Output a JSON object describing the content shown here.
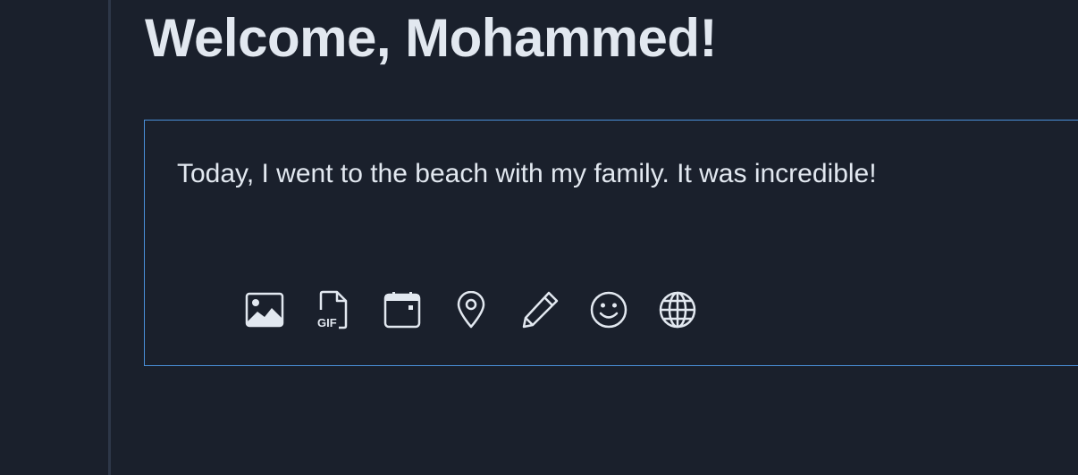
{
  "header": {
    "welcome": "Welcome, Mohammed!"
  },
  "composer": {
    "text": "Today, I went to the beach with my family. It was incredible!",
    "toolbar": {
      "icons": [
        "image-icon",
        "gif-icon",
        "calendar-icon",
        "location-icon",
        "pencil-icon",
        "emoji-icon",
        "globe-icon"
      ],
      "gif_label": "GIF"
    }
  },
  "colors": {
    "background": "#1a202c",
    "text": "#e2e8f0",
    "accent_border": "#4a90d9",
    "divider": "#2d3748"
  }
}
